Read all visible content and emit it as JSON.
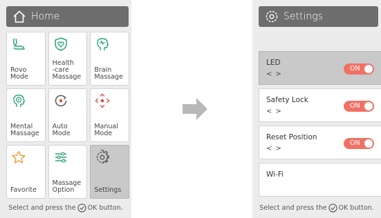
{
  "left": {
    "title": "Home",
    "tiles": [
      {
        "label": "Rovo\nMode",
        "icon": "seat-icon"
      },
      {
        "label": "Health\n-care\nMassage",
        "icon": "heart-shield-icon"
      },
      {
        "label": "Brain\nMassage",
        "icon": "brain-head-icon"
      },
      {
        "label": "Mental\nMassage",
        "icon": "mind-head-icon"
      },
      {
        "label": "Auto\nMode",
        "icon": "auto-circle-icon"
      },
      {
        "label": "Manual\nMode",
        "icon": "manual-arrows-icon"
      },
      {
        "label": "Favorite",
        "icon": "star-icon"
      },
      {
        "label": "Massage\nOption",
        "icon": "sliders-icon"
      },
      {
        "label": "Settings",
        "icon": "gear-icon"
      }
    ],
    "selected_tile": "Settings",
    "footer_before": "Select and press the",
    "footer_after": "OK button."
  },
  "right": {
    "title": "Settings",
    "rows": [
      {
        "label": "LED",
        "arrows": "< >",
        "toggle": "ON"
      },
      {
        "label": "Safety Lock",
        "arrows": "< >",
        "toggle": "ON"
      },
      {
        "label": "Reset Position",
        "arrows": "< >",
        "toggle": "ON"
      },
      {
        "label": "Wi-Fi"
      }
    ],
    "selected_row": "LED",
    "footer_before": "Select and press the",
    "footer_after": "OK button."
  },
  "colors": {
    "header": "#6d6d6d",
    "panel": "#ececec",
    "toggle_on": "#ef7165",
    "icon_green": "#2aa37a",
    "icon_orange": "#f29b2f",
    "icon_red": "#e2463e",
    "arrow": "#b8b8b8"
  }
}
